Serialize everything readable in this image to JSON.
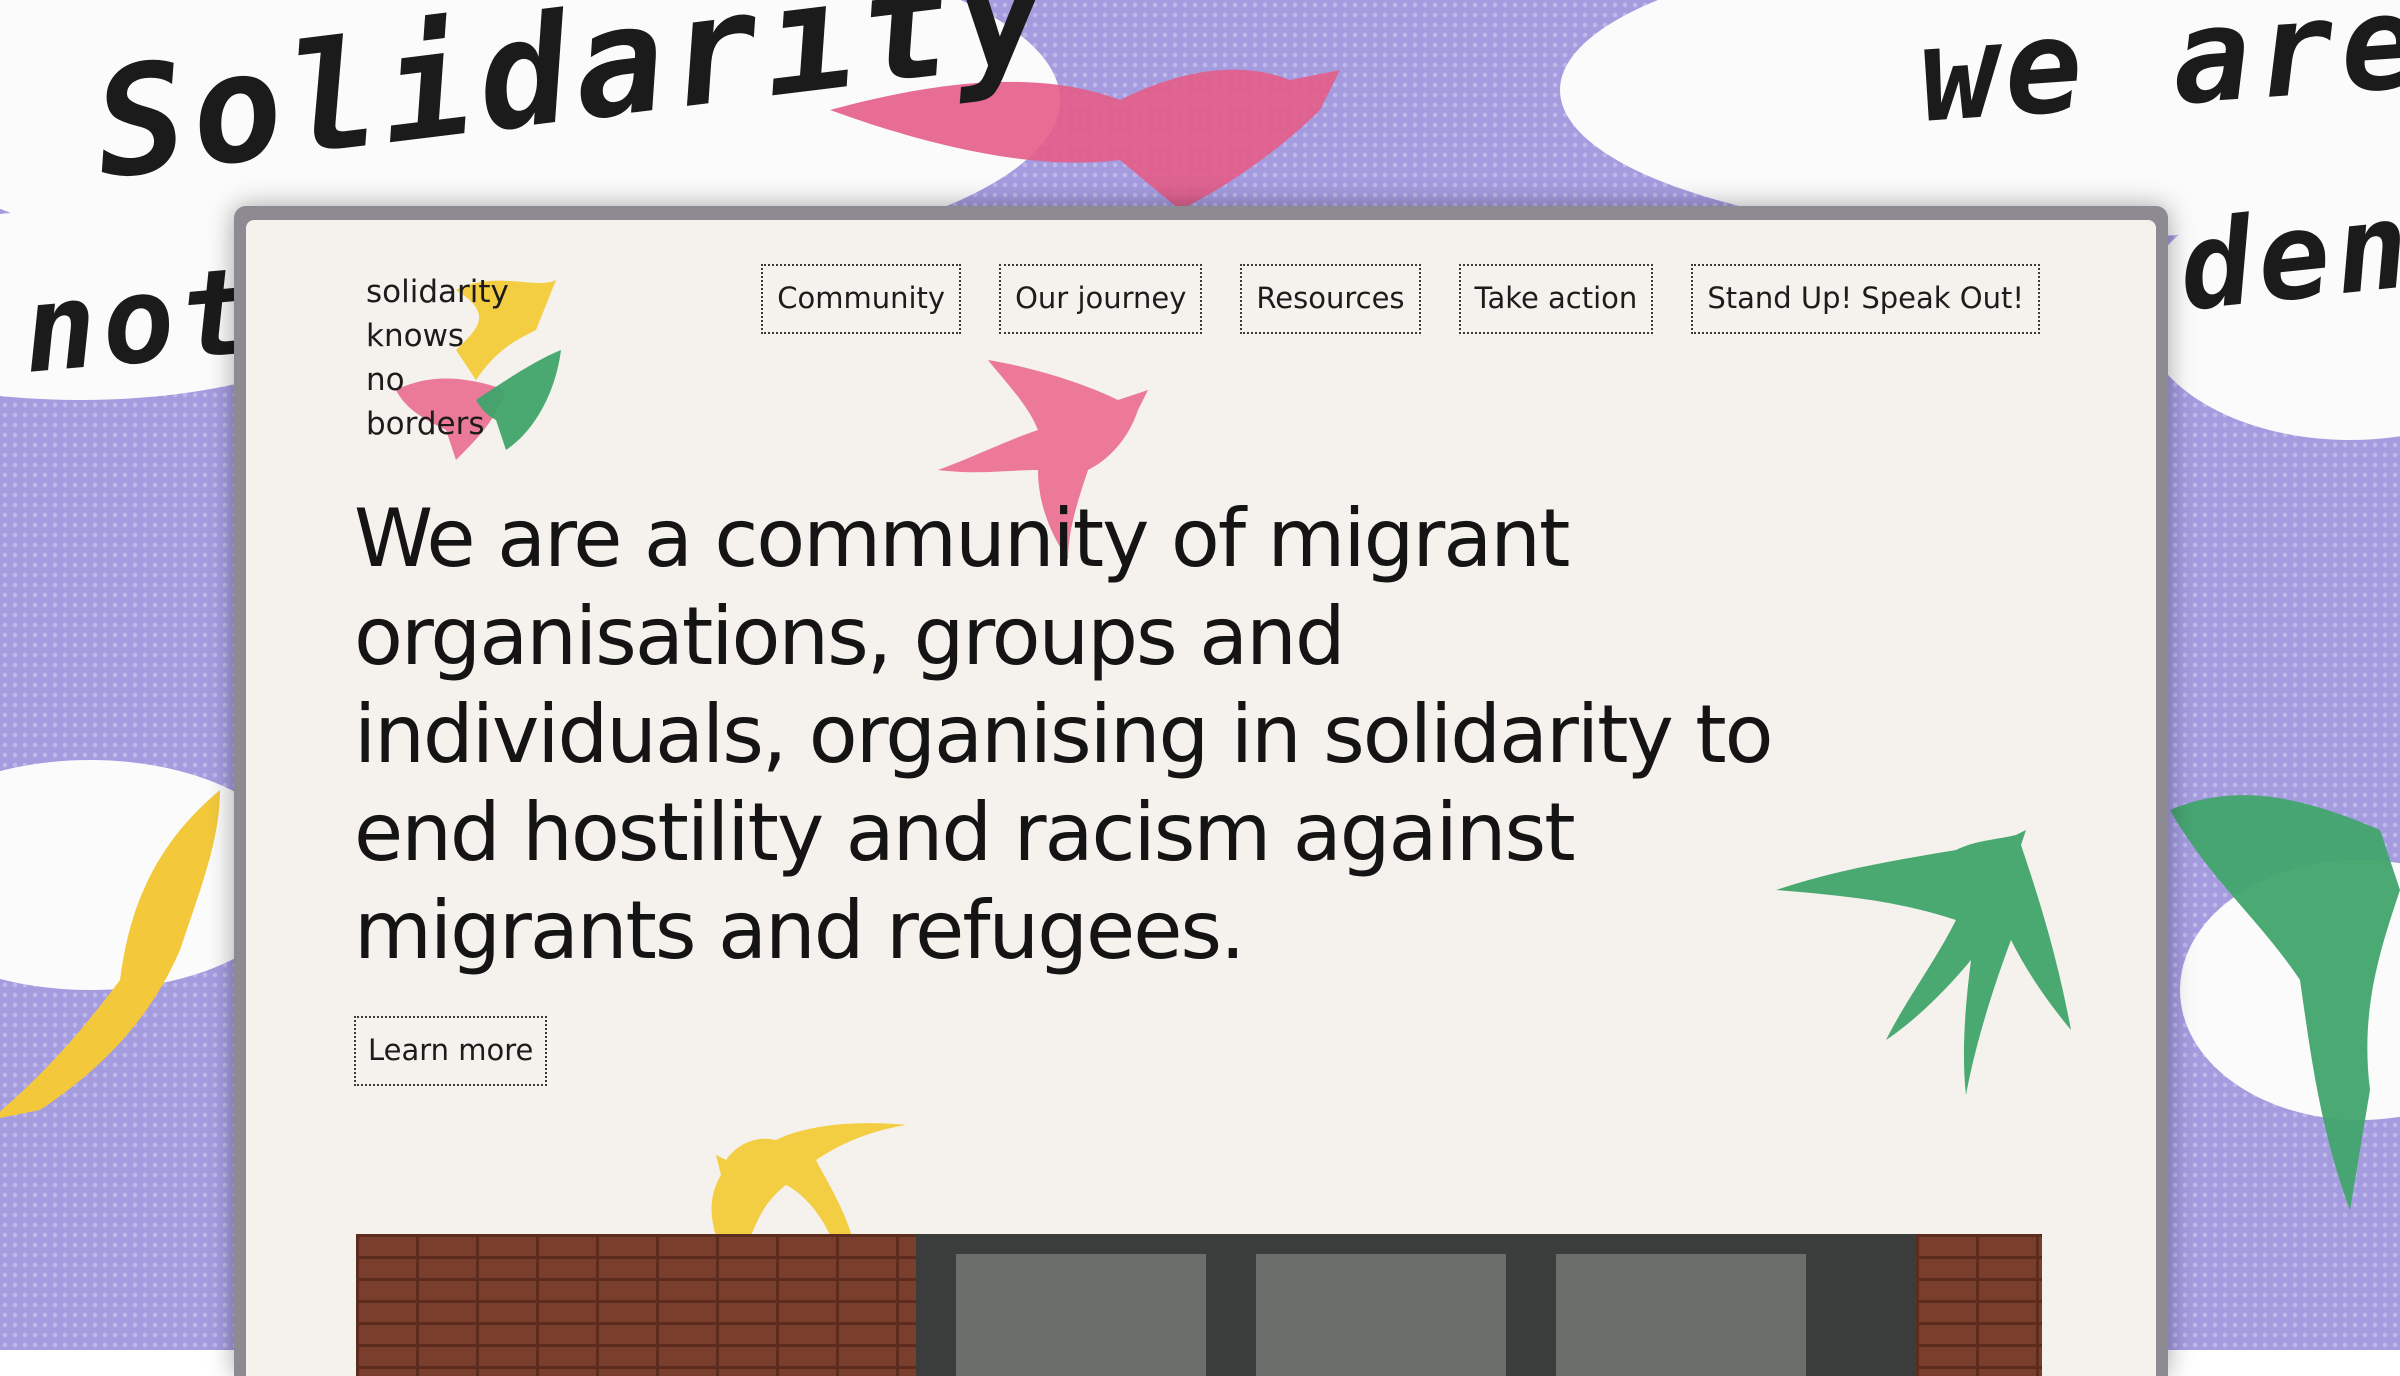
{
  "background": {
    "handwritten_words": [
      "Solidarity",
      "not",
      "we are",
      "dent"
    ]
  },
  "logo": {
    "lines": [
      "solidarity",
      "knows",
      "no",
      "borders"
    ]
  },
  "nav": {
    "items": [
      {
        "label": "Community"
      },
      {
        "label": "Our journey"
      },
      {
        "label": "Resources"
      },
      {
        "label": "Take action"
      },
      {
        "label": "Stand Up! Speak Out!"
      }
    ]
  },
  "hero": {
    "heading": "We are a community of migrant organisations, groups and individuals, organising in solidarity to end hostility and racism against migrants and refugees.",
    "cta_label": "Learn more"
  },
  "colors": {
    "page_background": "#f5f1ec",
    "backdrop_purple": "#a59ce0",
    "swallow_pink": "#e96d8e",
    "swallow_green": "#3fa46a",
    "swallow_yellow": "#f2cb3a",
    "text": "#141414"
  },
  "icons": [
    "swallow-pink-icon",
    "swallow-green-icon",
    "swallow-yellow-icon",
    "logo-swallows-icon"
  ]
}
